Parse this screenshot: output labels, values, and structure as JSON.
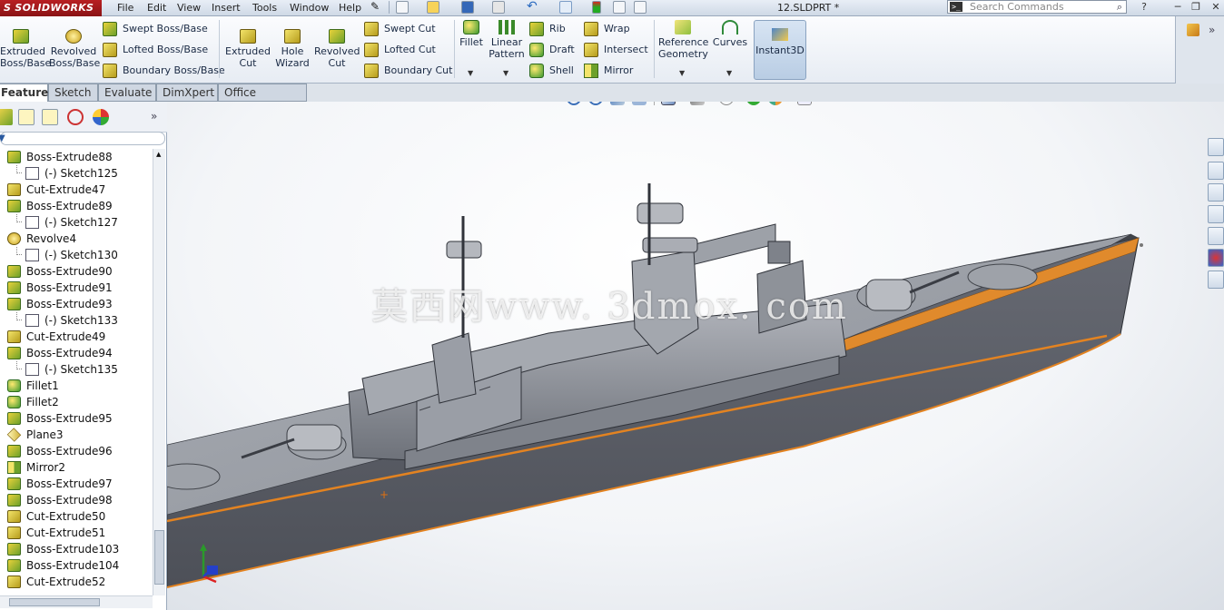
{
  "app": {
    "logo_text": "S SOLIDWORKS",
    "document_title": "12.SLDPRT *"
  },
  "menu": [
    "File",
    "Edit",
    "View",
    "Insert",
    "Tools",
    "Window",
    "Help"
  ],
  "search": {
    "placeholder": "Search Commands",
    "glyph": ">_"
  },
  "ribbon": {
    "extruded_boss": "Extruded\nBoss/Base",
    "revolved_boss": "Revolved\nBoss/Base",
    "swept_boss": "Swept Boss/Base",
    "lofted_boss": "Lofted Boss/Base",
    "boundary_boss": "Boundary Boss/Base",
    "extruded_cut": "Extruded\nCut",
    "hole_wizard": "Hole\nWizard",
    "revolved_cut": "Revolved\nCut",
    "swept_cut": "Swept Cut",
    "lofted_cut": "Lofted Cut",
    "boundary_cut": "Boundary Cut",
    "fillet": "Fillet",
    "linear_pattern": "Linear\nPattern",
    "rib": "Rib",
    "draft": "Draft",
    "shell": "Shell",
    "wrap": "Wrap",
    "intersect": "Intersect",
    "mirror": "Mirror",
    "reference_geometry": "Reference\nGeometry",
    "curves": "Curves",
    "instant3d": "Instant3D"
  },
  "tabs": [
    "Features",
    "Sketch",
    "Evaluate",
    "DimXpert",
    "Office Products"
  ],
  "tree": [
    {
      "label": "Boss-Extrude88",
      "type": "boss",
      "level": 0
    },
    {
      "label": "(-) Sketch125",
      "type": "sketch",
      "level": 1
    },
    {
      "label": "Cut-Extrude47",
      "type": "cut",
      "level": 0
    },
    {
      "label": "Boss-Extrude89",
      "type": "boss",
      "level": 0
    },
    {
      "label": "(-) Sketch127",
      "type": "sketch",
      "level": 1
    },
    {
      "label": "Revolve4",
      "type": "revolve",
      "level": 0
    },
    {
      "label": "(-) Sketch130",
      "type": "sketch",
      "level": 1
    },
    {
      "label": "Boss-Extrude90",
      "type": "boss",
      "level": 0
    },
    {
      "label": "Boss-Extrude91",
      "type": "boss",
      "level": 0
    },
    {
      "label": "Boss-Extrude93",
      "type": "boss",
      "level": 0
    },
    {
      "label": "(-) Sketch133",
      "type": "sketch",
      "level": 1
    },
    {
      "label": "Cut-Extrude49",
      "type": "cut",
      "level": 0
    },
    {
      "label": "Boss-Extrude94",
      "type": "boss",
      "level": 0
    },
    {
      "label": "(-) Sketch135",
      "type": "sketch",
      "level": 1
    },
    {
      "label": "Fillet1",
      "type": "fillet",
      "level": 0
    },
    {
      "label": "Fillet2",
      "type": "fillet",
      "level": 0
    },
    {
      "label": "Boss-Extrude95",
      "type": "boss",
      "level": 0
    },
    {
      "label": "Plane3",
      "type": "plane",
      "level": 0
    },
    {
      "label": "Boss-Extrude96",
      "type": "boss",
      "level": 0
    },
    {
      "label": "Mirror2",
      "type": "mirror",
      "level": 0
    },
    {
      "label": "Boss-Extrude97",
      "type": "boss",
      "level": 0
    },
    {
      "label": "Boss-Extrude98",
      "type": "boss",
      "level": 0
    },
    {
      "label": "Cut-Extrude50",
      "type": "cut",
      "level": 0
    },
    {
      "label": "Cut-Extrude51",
      "type": "cut",
      "level": 0
    },
    {
      "label": "Boss-Extrude103",
      "type": "boss",
      "level": 0
    },
    {
      "label": "Boss-Extrude104",
      "type": "boss",
      "level": 0
    },
    {
      "label": "Cut-Extrude52",
      "type": "cut",
      "level": 0
    }
  ],
  "viewport": {
    "watermark": "莫西网www. 3dmox. com"
  },
  "colors": {
    "hull": "#5b5e66",
    "hull_edge": "#e38321",
    "deck": "#9a9ea6",
    "superstructure": "#8c9098"
  }
}
